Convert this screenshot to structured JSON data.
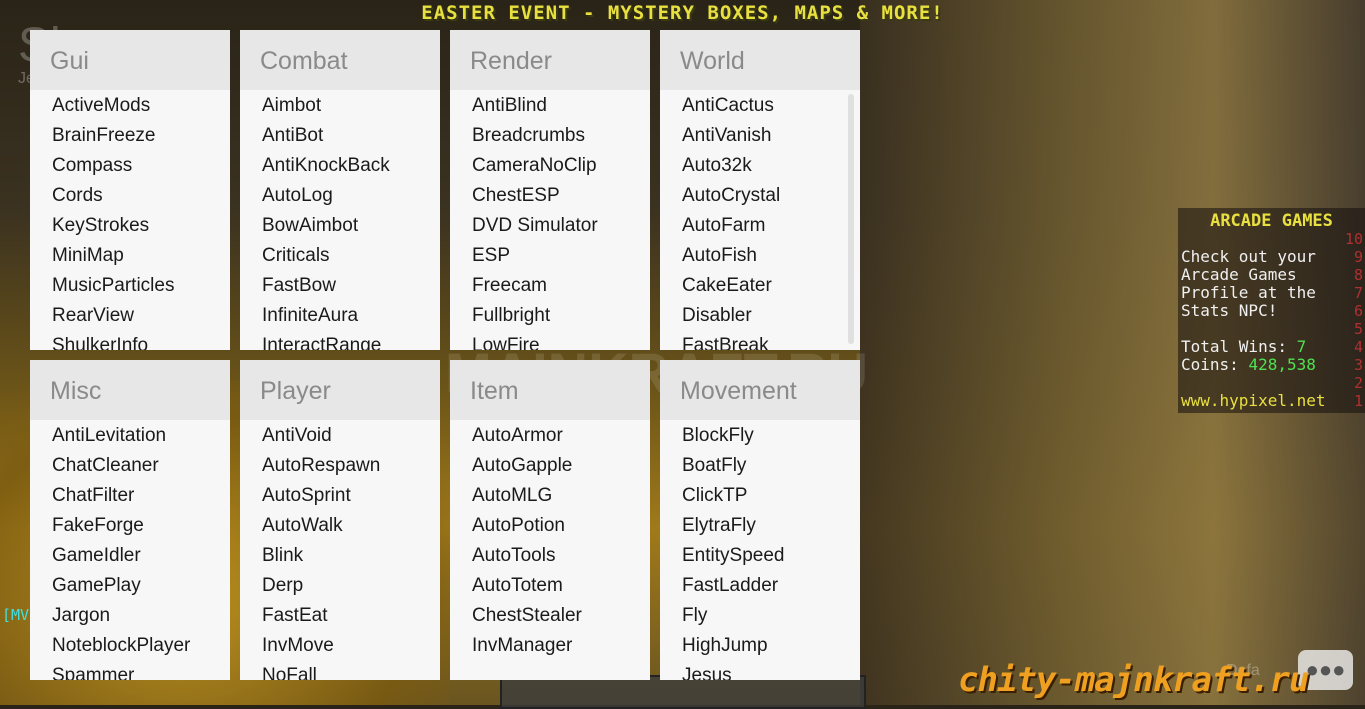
{
  "banner": "EASTER EVENT - MYSTERY BOXES, MAPS & MORE!",
  "client": {
    "name": "Sigma",
    "sub": "Jel"
  },
  "panels": [
    {
      "title": "Gui",
      "items": [
        "ActiveMods",
        "BrainFreeze",
        "Compass",
        "Cords",
        "KeyStrokes",
        "MiniMap",
        "MusicParticles",
        "RearView",
        "ShulkerInfo"
      ]
    },
    {
      "title": "Combat",
      "items": [
        "Aimbot",
        "AntiBot",
        "AntiKnockBack",
        "AutoLog",
        "BowAimbot",
        "Criticals",
        "FastBow",
        "InfiniteAura",
        "InteractRange"
      ]
    },
    {
      "title": "Render",
      "items": [
        "AntiBlind",
        "Breadcrumbs",
        "CameraNoClip",
        "ChestESP",
        "DVD Simulator",
        "ESP",
        "Freecam",
        "Fullbright",
        "LowFire"
      ]
    },
    {
      "title": "World",
      "items": [
        "AntiCactus",
        "AntiVanish",
        "Auto32k",
        "AutoCrystal",
        "AutoFarm",
        "AutoFish",
        "CakeEater",
        "Disabler",
        "FastBreak"
      ]
    },
    {
      "title": "Misc",
      "items": [
        "AntiLevitation",
        "ChatCleaner",
        "ChatFilter",
        "FakeForge",
        "GameIdler",
        "GamePlay",
        "Jargon",
        "NoteblockPlayer",
        "Spammer"
      ]
    },
    {
      "title": "Player",
      "items": [
        "AntiVoid",
        "AutoRespawn",
        "AutoSprint",
        "AutoWalk",
        "Blink",
        "Derp",
        "FastEat",
        "InvMove",
        "NoFall"
      ]
    },
    {
      "title": "Item",
      "items": [
        "AutoArmor",
        "AutoGapple",
        "AutoMLG",
        "AutoPotion",
        "AutoTools",
        "AutoTotem",
        "ChestStealer",
        "InvManager"
      ]
    },
    {
      "title": "Movement",
      "items": [
        "BlockFly",
        "BoatFly",
        "ClickTP",
        "ElytraFly",
        "EntitySpeed",
        "FastLadder",
        "Fly",
        "HighJump",
        "Jesus"
      ]
    }
  ],
  "scoreboard": {
    "title": "ARCADE GAMES",
    "lines": [
      "Check out your",
      "Arcade Games",
      "Profile at the",
      "Stats NPC!"
    ],
    "wins_label": "Total Wins:",
    "wins": "7",
    "coins_label": "Coins:",
    "coins": "428,538",
    "site": "www.hypixel.net",
    "numbers": [
      "10",
      "9",
      "8",
      "7",
      "6",
      "5",
      "4",
      "3",
      "2",
      "1"
    ]
  },
  "watermark": "chity-majnkraft.ru",
  "watermark_center": "MAINKRAFT.RU",
  "chat_fragment": "[MV",
  "default_label": "Defa"
}
